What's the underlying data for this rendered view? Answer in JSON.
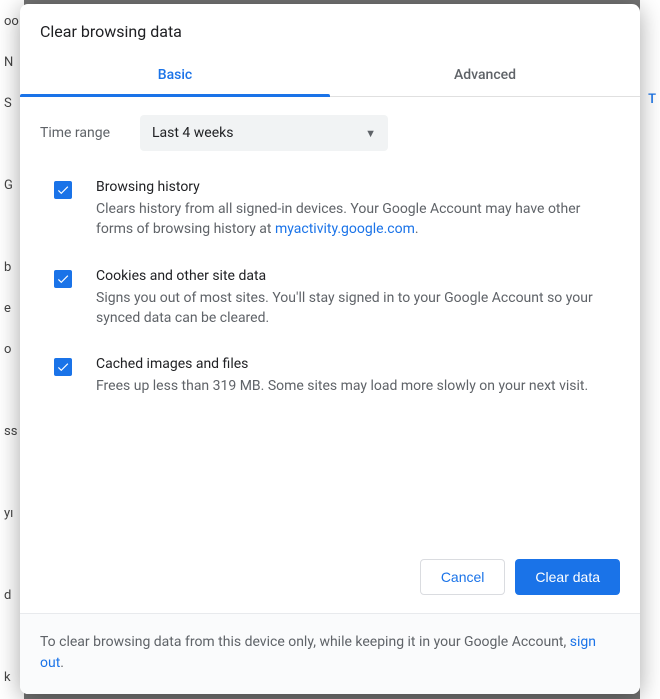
{
  "dialog": {
    "title": "Clear browsing data",
    "tabs": {
      "basic": "Basic",
      "advanced": "Advanced"
    },
    "time_range_label": "Time range",
    "time_range_value": "Last 4 weeks",
    "options": [
      {
        "title": "Browsing history",
        "desc_pre": "Clears history from all signed-in devices. Your Google Account may have other forms of browsing history at ",
        "link": "myactivity.google.com",
        "desc_post": ".",
        "checked": true
      },
      {
        "title": "Cookies and other site data",
        "desc_pre": "Signs you out of most sites. You'll stay signed in to your Google Account so your synced data can be cleared.",
        "link": "",
        "desc_post": "",
        "checked": true
      },
      {
        "title": "Cached images and files",
        "desc_pre": "Frees up less than 319 MB. Some sites may load more slowly on your next visit.",
        "link": "",
        "desc_post": "",
        "checked": true
      }
    ],
    "cancel": "Cancel",
    "confirm": "Clear data",
    "footer_pre": "To clear browsing data from this device only, while keeping it in your Google Account, ",
    "footer_link": "sign out",
    "footer_post": "."
  },
  "bg": {
    "rows": [
      "oo",
      "N",
      "S",
      "",
      "G",
      "",
      "b",
      "e",
      "o",
      "",
      "ss",
      "",
      "yı",
      "",
      "d",
      "",
      "k"
    ],
    "right_t": "T"
  }
}
